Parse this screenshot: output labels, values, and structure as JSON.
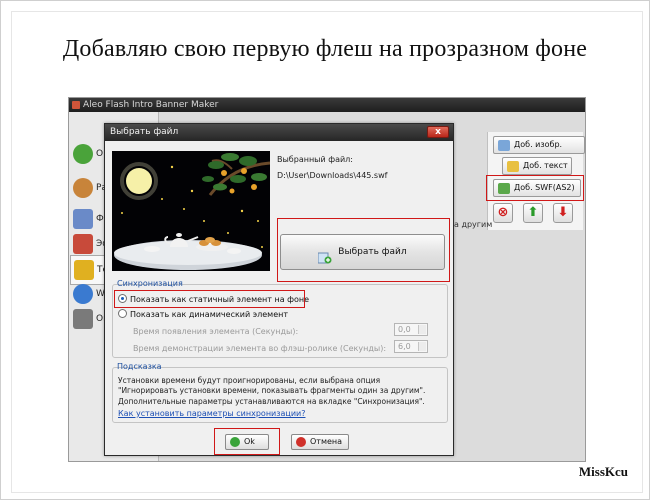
{
  "slide": {
    "title": "Добавляю свою первую флеш на прозразном фоне",
    "signature": "MissKcu"
  },
  "app": {
    "title": "Aleo Flash Intro Banner Maker",
    "sidebar": [
      {
        "label": "О п",
        "icon": "home-icon",
        "color": "#4aa33a"
      },
      {
        "label": "Ра",
        "icon": "palette-icon",
        "color": "#c8843a"
      },
      {
        "label": "Фо",
        "icon": "image-icon",
        "color": "#6a8ac8"
      },
      {
        "label": "Эф",
        "icon": "effects-icon",
        "color": "#c84a3a"
      },
      {
        "label": "Те",
        "icon": "pencil-icon",
        "color": "#e0b020"
      },
      {
        "label": "We",
        "icon": "globe-icon",
        "color": "#3a7ad0"
      },
      {
        "label": "Оп",
        "icon": "tools-icon",
        "color": "#7a7a7a"
      }
    ],
    "buttons": {
      "add_image": "Доб. изобр.",
      "add_text": "Доб. текст",
      "add_swf": "Доб. SWF(AS2)"
    },
    "partial_text": "а другим",
    "colors": {
      "delete": "#d02020",
      "up": "#2a9a2a",
      "down": "#d02020"
    }
  },
  "dialog": {
    "title": "Выбрать файл",
    "close_label": "x",
    "selected_label": "Выбранный файл:",
    "selected_path": "D:\\User\\Downloads\\445.swf",
    "choose_button": "Выбрать файл",
    "sync": {
      "title": "Синхронизация",
      "option_static": "Показать как статичный элемент на фоне",
      "option_dynamic": "Показать как динамический элемент",
      "selected": "static",
      "appear_label": "Время появления элемента (Секунды):",
      "appear_value": "0,0",
      "duration_label": "Время демонстрации элемента во флэш-ролике (Секунды):",
      "duration_value": "6,0"
    },
    "hint": {
      "title": "Подсказка",
      "line1": "Установки времени будут проигнорированы, если выбрана опция \"Игнорировать установки времени, показывать фрагменты один за другим\".",
      "line2": "Дополнительные параметры устанавливаются на вкладке \"Синхронизация\".",
      "link": "Как установить параметры синхронизации?"
    },
    "ok_label": "Ok",
    "cancel_label": "Отмена"
  },
  "highlight_color": "#d01818"
}
